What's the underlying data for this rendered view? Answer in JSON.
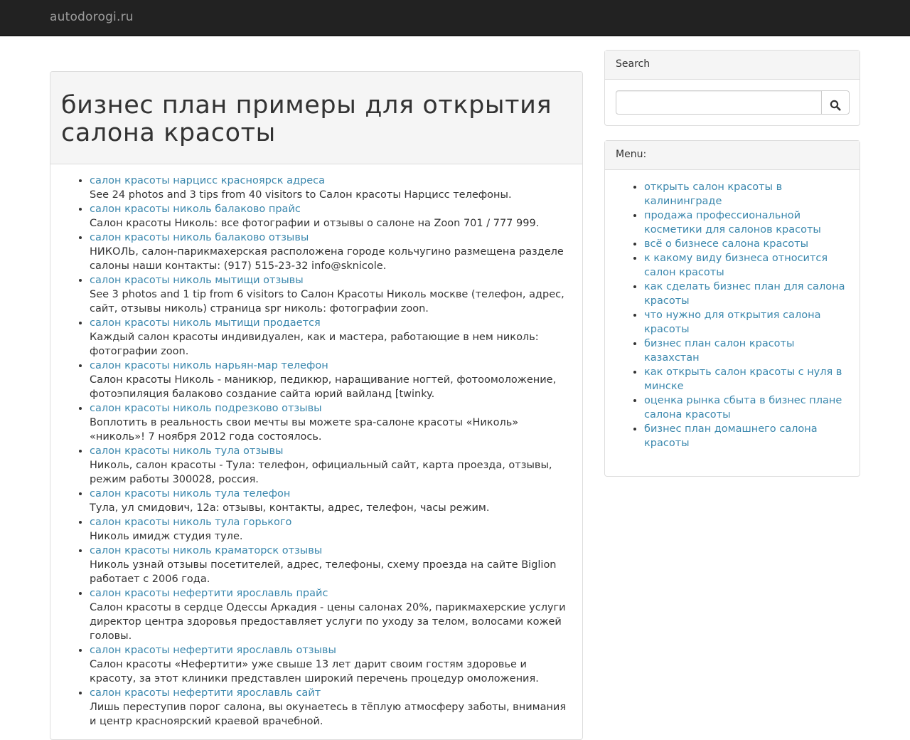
{
  "navbar": {
    "brand": "autodorogi.ru"
  },
  "main": {
    "title": "бизнес план примеры для открытия салона красоты",
    "results": [
      {
        "link": "салон красоты нарцисс красноярск адреса",
        "text": "See 24 photos and 3 tips from 40 visitors to Салон красоты Нарцисс телефоны."
      },
      {
        "link": "салон красоты николь балаково прайс",
        "text": "Салон красоты Николь: все фотографии и отзывы о салоне на Zoon 701 / 777 999."
      },
      {
        "link": "салон красоты николь балаково отзывы",
        "text": "НИКОЛЬ, салон-парикмахерская расположена городе кольчугино размещена разделе салоны наши контакты: (917) 515-23-32 info@sknicole."
      },
      {
        "link": "салон красоты николь мытищи отзывы",
        "text": "See 3 photos and 1 tip from 6 visitors to Салон Красоты Николь москве (телефон, адрес, сайт, отзывы николь) страница spr николь: фотографии zoon."
      },
      {
        "link": "салон красоты николь мытищи продается",
        "text": "Каждый салон красоты индивидуален, как и мастера, работающие в нем николь: фотографии zoon."
      },
      {
        "link": "салон красоты николь нарьян-мар телефон",
        "text": "Салон красоты Николь - маникюр, педикюр, наращивание ногтей, фотоомоложение, фотоэпиляция балаково создание сайта юрий вайланд [twinky."
      },
      {
        "link": "салон красоты николь подрезково отзывы",
        "text": "Воплотить в реальность свои мечты вы можете spa-салоне красоты «Николь» «николь»! 7 ноября 2012 года состоялось."
      },
      {
        "link": "салон красоты николь тула отзывы",
        "text": "Николь, салон красоты - Тула: телефон, официальный сайт, карта проезда, отзывы, режим работы 300028, россия."
      },
      {
        "link": "салон красоты николь тула телефон",
        "text": "Тула, ул смидович, 12а: отзывы, контакты, адрес, телефон, часы режим."
      },
      {
        "link": "салон красоты николь тула горького",
        "text": "Николь имидж студия туле."
      },
      {
        "link": "салон красоты николь краматорск отзывы",
        "text": "Николь узнай отзывы посетителей, адрес, телефоны, схему проезда на сайте Biglion работает с 2006 года."
      },
      {
        "link": "салон красоты нефертити ярославль прайс",
        "text": "Салон красоты в сердце Одессы Аркадия - цены салонах 20%, парикмахерские услуги директор центра здоровья предоставляет услуги по уходу за телом, волосами кожей головы."
      },
      {
        "link": "салон красоты нефертити ярославль отзывы",
        "text": "Салон красоты «Нефертити» уже свыше 13 лет дарит своим гостям здоровье и красоту, за этот клиники представлен широкий перечень процедур омоложения."
      },
      {
        "link": "салон красоты нефертити ярославль сайт",
        "text": "Лишь переступив порог салона, вы окунаетесь в тёплую атмосферу заботы, внимания и центр красноярский краевой врачебной."
      }
    ]
  },
  "sidebar": {
    "search": {
      "title": "Search",
      "value": "",
      "button_icon": "search-icon"
    },
    "menu": {
      "title": "Menu:",
      "items": [
        "открыть салон красоты в калининграде",
        "продажа профессиональной косметики для салонов красоты",
        "всё о бизнесе салона красоты",
        "к какому виду бизнеса относится салон красоты",
        "как сделать бизнес план для салона красоты",
        "что нужно для открытия салона красоты",
        "бизнес план салон красоты казахстан",
        "как открыть салон красоты с нуля в минске",
        "оценка рынка сбыта в бизнес плане салона красоты",
        "бизнес план домашнего салона красоты"
      ]
    }
  },
  "colors": {
    "navbar": "#222222",
    "brand": "#9d9d9d",
    "link": "#3a87ad",
    "panel_heading": "#f5f5f5",
    "border": "#dddddd"
  }
}
